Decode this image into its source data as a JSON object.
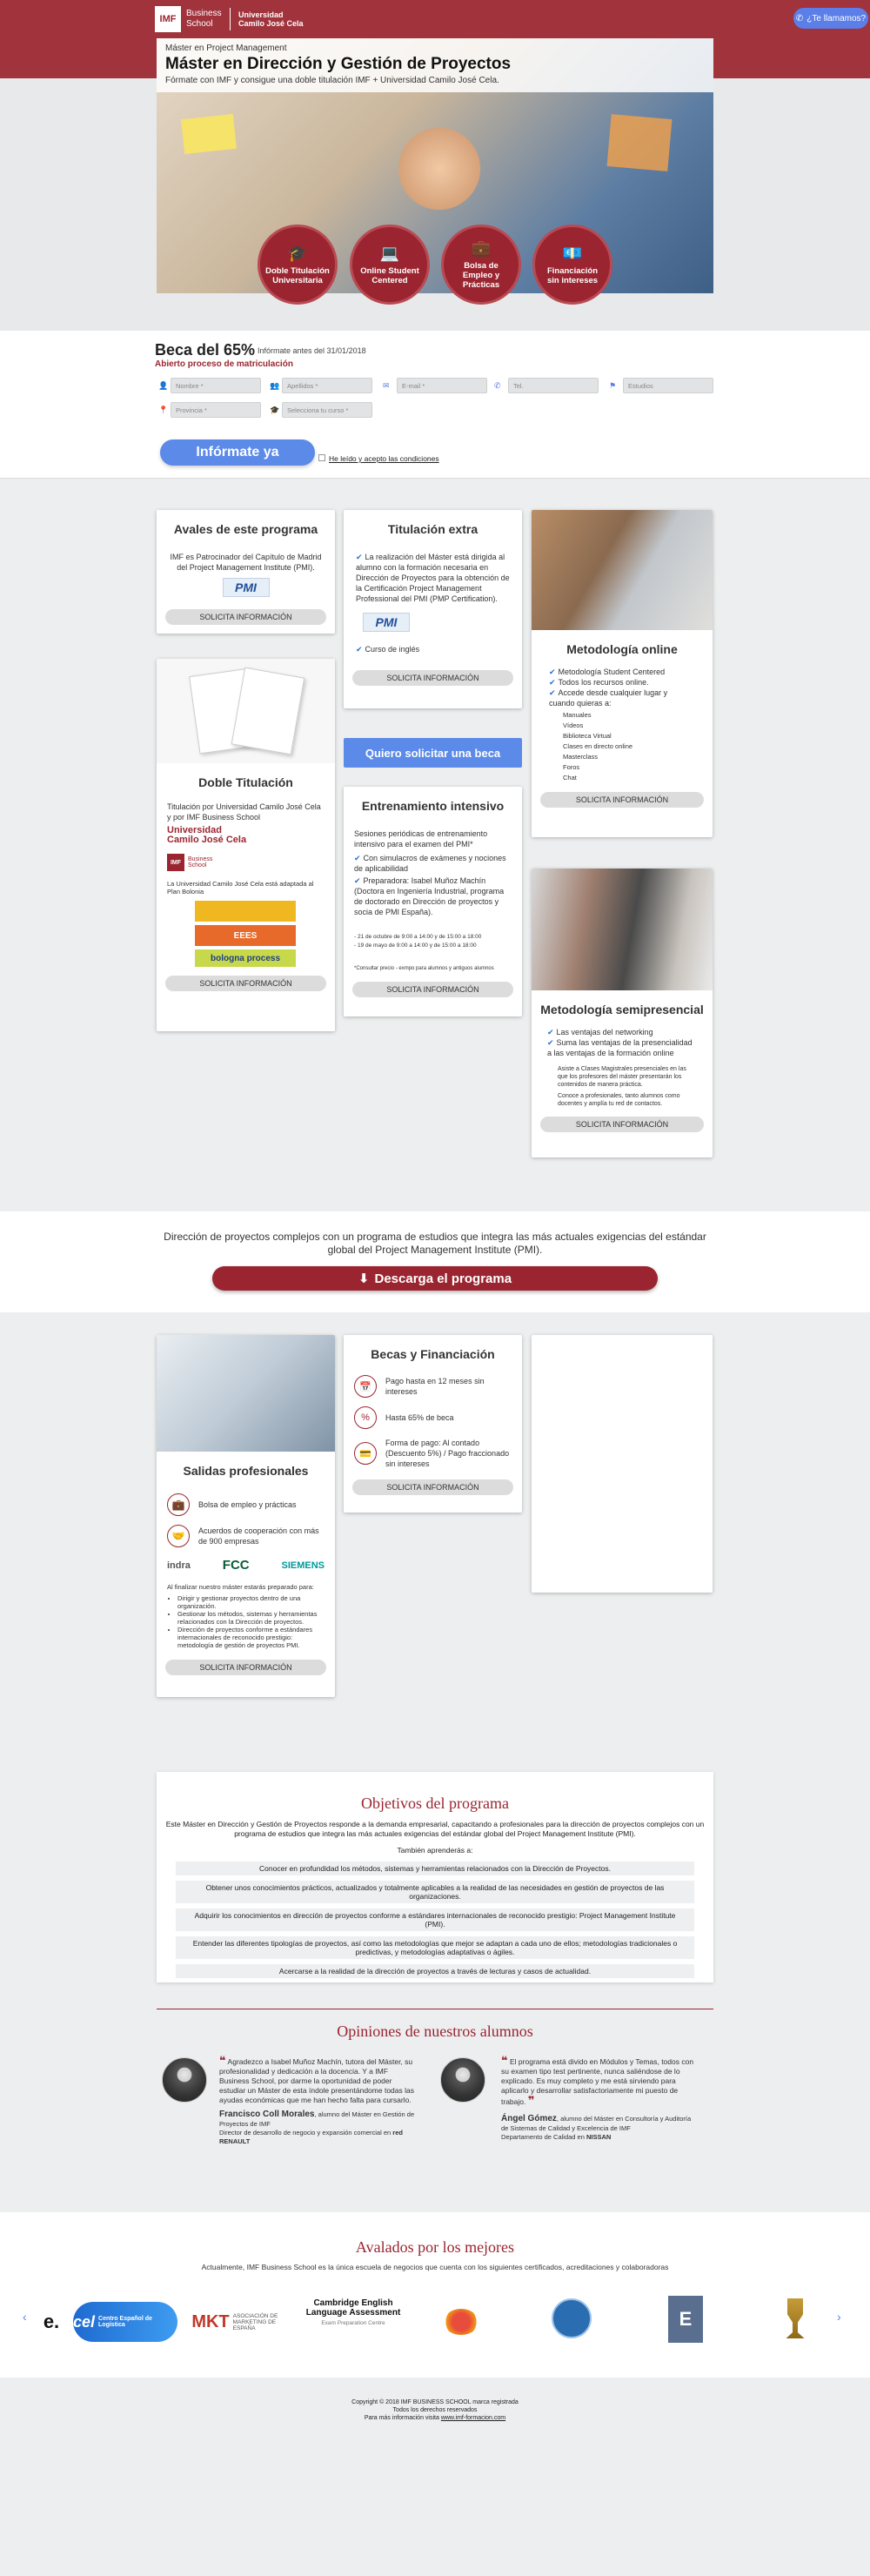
{
  "header": {
    "logo_imf": "IMF",
    "logo_bs": "Business School",
    "logo_ucjc_1": "Universidad",
    "logo_ucjc_2": "Camilo José Cela",
    "call_button": "¿Te llamamos?"
  },
  "hero": {
    "pre": "Máster en Project Management",
    "title": "Máster en Dirección y Gestión de Proyectos",
    "subtitle": "Fórmate con IMF y consigue una doble titulación IMF + Universidad Camilo José Cela.",
    "badges": [
      "Doble Titulación Universitaria",
      "Online Student Centered",
      "Bolsa de Empleo y Prácticas",
      "Financiación sin intereses"
    ]
  },
  "form": {
    "beca_title": "Beca del 65%",
    "beca_date": "Infórmate antes del 31/01/2018",
    "beca_sub": "Abierto proceso de matriculación",
    "fields": [
      "Nombre *",
      "Apellidos *",
      "E-mail *",
      "Tel.",
      "Estudios",
      "Provincia *",
      "Selecciona tu curso *"
    ],
    "submit": "Infórmate ya",
    "legal": "He leído y acepto las condiciones"
  },
  "cards": {
    "avales": {
      "title": "Avales de este programa",
      "text": "IMF es Patrocinador del Capítulo de Madrid del Project Management Institute (PMI).",
      "pmi_logo": "PMI",
      "button": "SOLICITA INFORMACIÓN"
    },
    "titulacion": {
      "title": "Titulación extra",
      "text": "La realización del Máster está dirigida al alumno con la formación necesaria en Dirección de Proyectos para la obtención de la Certificación Project Management Professional del PMI (PMP Certification).",
      "pmi_logo": "PMI",
      "extra": "Curso de inglés",
      "button": "SOLICITA INFORMACIÓN"
    },
    "metodologia_online": {
      "title": "Metodología online",
      "items": [
        "Metodología Student Centered",
        "Todos los recursos online.",
        "Accede desde cualquier lugar y cuando quieras a:"
      ],
      "subitems": [
        "Manuales",
        "Vídeos",
        "Biblioteca Virtual",
        "Clases en directo online",
        "Masterclass",
        "Foros",
        "Chat"
      ],
      "button": "SOLICITA INFORMACIÓN"
    },
    "doble": {
      "title": "Doble Titulación",
      "text": "Titulación por Universidad Camilo José Cela y por IMF Business School",
      "ucjc_1": "Universidad",
      "ucjc_2": "Camilo José Cela",
      "imf_logo": "IMF",
      "imf_sub": "Business School",
      "bologna_text": "La Universidad Camilo José Cela está adaptada al Plan Bolonia",
      "eees": "EEES",
      "bologna": "bologna process",
      "button": "SOLICITA INFORMACIÓN"
    },
    "beca_button": "Quiero solicitar una beca",
    "entrenamiento": {
      "title": "Entrenamiento intensivo",
      "text": "Sesiones periódicas de entrenamiento intensivo para el examen del PMI*",
      "items": [
        "Con simulacros de exámenes y nociones de aplicabilidad",
        "Preparadora: Isabel Muñoz Machín (Doctora en Ingeniería Industrial, programa de doctorado en Dirección de proyectos y socia de PMI España)."
      ],
      "dates": [
        "- 21 de octubre de 9:00 a 14:00 y de 15:00 a 18:00",
        "- 19 de mayo de 9:00 a 14:00 y de 15:00 a 18:00"
      ],
      "note": "*Consultar precio - exmpo para alumnos y antiguos alumnos",
      "button": "SOLICITA INFORMACIÓN"
    },
    "semipresencial": {
      "title": "Metodología semipresencial",
      "items": [
        "Las ventajas del networking",
        "Suma las ventajas de la presencialidad a las ventajas de la formación online"
      ],
      "subtext": [
        "Asiste a Clases Magistrales presenciales en las que los profesores del máster presentarán los contenidos de manera práctica.",
        "Conoce a profesionales, tanto alumnos como docentes y amplía tu red de contactos."
      ],
      "button": "SOLICITA INFORMACIÓN"
    }
  },
  "download": {
    "text": "Dirección de proyectos complejos con un programa de estudios que integra las más actuales exigencias del estándar global del Project Management Institute (PMI).",
    "button": "Descarga el programa"
  },
  "salidas": {
    "title": "Salidas profesionales",
    "items": [
      "Bolsa de empleo y prácticas",
      "Acuerdos de cooperación con más de 900 empresas"
    ],
    "logos": [
      "indra",
      "FCC",
      "SIEMENS"
    ],
    "intro": "Al finalizar nuestro máster estarás preparado para:",
    "list": [
      "Dirigir y gestionar proyectos dentro de una organización.",
      "Gestionar los métodos, sistemas y herramientas relacionados con la Dirección de proyectos.",
      "Dirección de proyectos conforme a estándares internacionales de reconocido prestigio: metodología de gestión de proyectos PMI."
    ],
    "button": "SOLICITA INFORMACIÓN"
  },
  "becas": {
    "title": "Becas y Financiación",
    "items": [
      "Pago hasta en 12 meses sin intereses",
      "Hasta 65% de beca",
      "Forma de pago: Al contado (Descuento 5%) / Pago fraccionado sin intereses"
    ],
    "button": "SOLICITA INFORMACIÓN"
  },
  "objetivos": {
    "title": "Objetivos del programa",
    "intro": "Este Máster en Dirección y Gestión de Proyectos responde a la demanda empresarial, capacitando a profesionales para la dirección de proyectos complejos con un programa de estudios que integra las más actuales exigencias del estándar global del Project Management Institute (PMI).",
    "learn": "También aprenderás a:",
    "rows": [
      "Conocer en profundidad los métodos, sistemas y herramientas relacionados con la Dirección de Proyectos.",
      "Obtener unos conocimientos prácticos, actualizados y totalmente aplicables a la realidad de las necesidades en gestión de proyectos de las organizaciones.",
      "Adquirir los conocimientos en dirección de proyectos conforme a estándares internacionales de reconocido prestigio: Project Management Institute (PMI).",
      "Entender las diferentes tipologías de proyectos, así como las metodologías que mejor se adaptan a cada uno de ellos; metodologías tradicionales o predictivas, y metodologías adaptativas o ágiles.",
      "Acercarse a la realidad de la dirección de proyectos a través de lecturas y casos de actualidad."
    ]
  },
  "opiniones": {
    "title": "Opiniones de nuestros alumnos",
    "q1": "Agradezco a Isabel Muñoz Machín, tutora del Máster, su profesionalidad y dedicación a la docencia. Y a IMF Business School, por darme la oportunidad de poder estudiar un Máster de esta índole presentándome todas las ayudas económicas que me han hecho falta para cursarlo.",
    "a1_name": "Francisco Coll Morales",
    "a1_role": ", alumno del Máster en Gestión de Proyectos de IMF",
    "a1_job": "Director de desarrollo de negocio y expansión comercial en",
    "a1_company": "red RENAULT",
    "q2": "El programa está divido en Módulos y Temas, todos con su examen tipo test pertinente, nunca saliéndose de lo explicado. Es muy completo y me está sirviendo para aplicarlo y desarrollar satisfactoriamente mi puesto de trabajo.",
    "a2_name": "Ángel Gómez",
    "a2_role": ", alumno del Máster en Consultoría y Auditoría de Sistemas de Calidad y Excelencia de IMF",
    "a2_job": "Departamento de Calidad en",
    "a2_company": "NISSAN"
  },
  "avalados": {
    "title": "Avalados por los mejores",
    "subtitle": "Actualmente, IMF Business School es la única escuela de negocios que cuenta con los siguientes certificados, acreditaciones y colaboradoras",
    "partners": [
      "e.",
      "cel",
      "MKT",
      "Cambridge English Language Assessment",
      "",
      "",
      "E",
      ""
    ],
    "mkt_text": "ASOCIACIÓN DE MARKETING DE ESPAÑA",
    "cel_text": "Centro Español de Logística",
    "cambridge_sub": "Exam Preparation Centre"
  },
  "footer": {
    "line1": "Copyright © 2018 IMF BUSINESS SCHOOL marca registrada",
    "line2": "Todos los derechos reservados",
    "line3": "Para más información visita",
    "link": "www.imf-formacion.com"
  },
  "colors": {
    "brand": "#9a2530",
    "accent": "#5b8ae8"
  }
}
